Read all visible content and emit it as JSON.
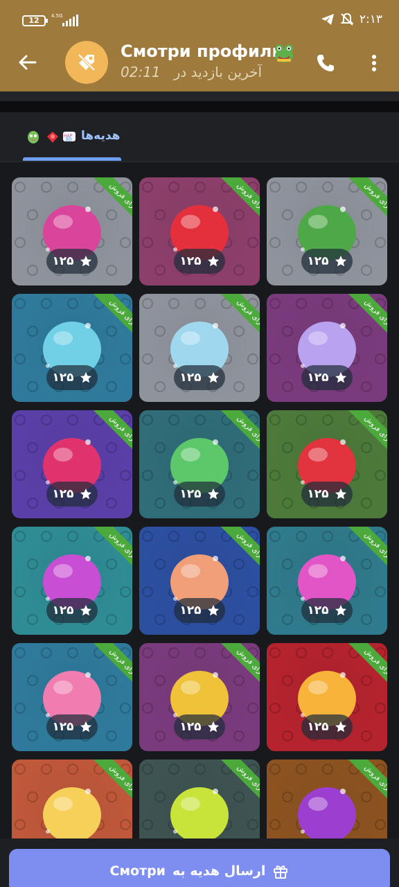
{
  "status_bar": {
    "battery": "12",
    "network": "4.5G",
    "time": "۲:۱۳"
  },
  "header": {
    "title": "Смотри профиль",
    "subtitle_prefix": "آخرین بازدید در",
    "subtitle_time": "02:11"
  },
  "tabs": [
    {
      "label": "هدیه‌ها",
      "selected": true
    }
  ],
  "gifts": [
    {
      "name": "happy-birthday",
      "price": "۱۲۵",
      "badge": "برای فروش",
      "bg": "#8f939c",
      "art": "#d9459a"
    },
    {
      "name": "red-star-ornament",
      "price": "۱۲۵",
      "badge": "برای فروش",
      "bg": "#8c3f6a",
      "art": "#e4303d"
    },
    {
      "name": "frog-egg",
      "price": "۱۲۵",
      "badge": "برای فروش",
      "bg": "#8f939c",
      "art": "#4fa848"
    },
    {
      "name": "candy-jar",
      "price": "۱۲۵",
      "badge": "برای فروش",
      "bg": "#2f7a9c",
      "art": "#6fd0e6"
    },
    {
      "name": "birthday-cake",
      "price": "۱۲۵",
      "badge": "برای فروش",
      "bg": "#8f939c",
      "art": "#9fd7ee"
    },
    {
      "name": "ribbon-bow",
      "price": "۱۲۵",
      "badge": "برای فروش",
      "bg": "#7a3b7c",
      "art": "#b9a2f0"
    },
    {
      "name": "magic-star-wand",
      "price": "۱۲۵",
      "badge": "برای فروش",
      "bg": "#5a3fa8",
      "art": "#e0336e"
    },
    {
      "name": "hot-drink",
      "price": "۱۲۵",
      "badge": "برای فروش",
      "bg": "#2f6d78",
      "art": "#5cc86a"
    },
    {
      "name": "heart-calendar",
      "price": "۱۲۵",
      "badge": "برای فروش",
      "bg": "#4d7a3b",
      "art": "#e2343f"
    },
    {
      "name": "lollipop",
      "price": "۱۲۵",
      "badge": "برای فروش",
      "bg": "#2f8c95",
      "art": "#c84fd3"
    },
    {
      "name": "candle",
      "price": "۱۲۵",
      "badge": "برای فروش",
      "bg": "#2d4fa0",
      "art": "#f09f78"
    },
    {
      "name": "tea-light",
      "price": "۱۲۵",
      "badge": "برای فروش",
      "bg": "#2f7a8c",
      "art": "#e255c6"
    },
    {
      "name": "ice-cream-sundae",
      "price": "۱۲۵",
      "badge": "برای فروش",
      "bg": "#2f7a9c",
      "art": "#f07cb0"
    },
    {
      "name": "bow-tie",
      "price": "۱۲۵",
      "badge": "برای فروش",
      "bg": "#7a3b7c",
      "art": "#f0c23a"
    },
    {
      "name": "fire-sword",
      "price": "۱۲۵",
      "badge": "برای فروش",
      "bg": "#b5232e",
      "art": "#f7b33a"
    },
    {
      "name": "sparkler",
      "price": "",
      "badge": "برای فروش",
      "bg": "#c0583a",
      "art": "#f7d05a"
    },
    {
      "name": "flower",
      "price": "",
      "badge": "برای فروش",
      "bg": "#3e5452",
      "art": "#c8e43a"
    },
    {
      "name": "snow-globe",
      "price": "",
      "badge": "برای فروش",
      "bg": "#8c5320",
      "art": "#9c3fd0"
    }
  ],
  "send_button": {
    "label": "ارسال هدیه به",
    "name": "Смотри"
  },
  "colors": {
    "header_bg": "#9e7b3c",
    "accent": "#6da0f5",
    "badge_green": "#4caa3c",
    "button": "#7e8ef0"
  }
}
